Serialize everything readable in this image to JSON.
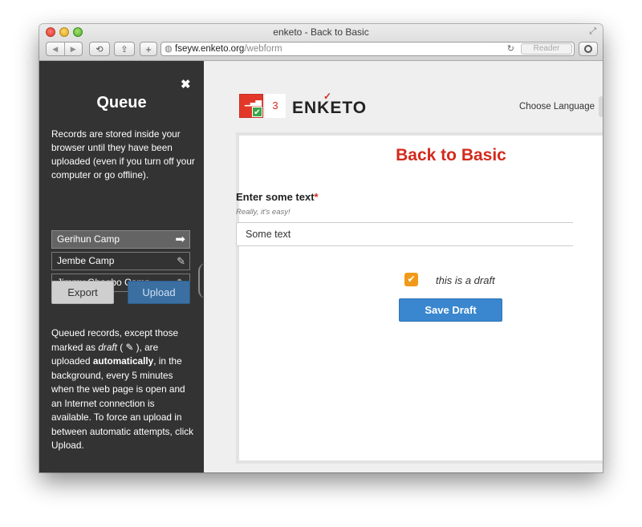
{
  "window": {
    "title": "enketo - Back to Basic"
  },
  "toolbar": {
    "url_host": "fseyw.enketo.org",
    "url_path": "/webform",
    "reader_label": "Reader",
    "add_label": "+"
  },
  "sidebar": {
    "title": "Queue",
    "description": "Records are stored inside your browser until they have been uploaded (even if you turn off your computer or go offline).",
    "records": [
      {
        "name": "Gerihun Camp",
        "icon": "arrow-right-icon"
      },
      {
        "name": "Jembe Camp",
        "icon": "pencil-icon"
      },
      {
        "name": "Jimmy Gbagbo Camp",
        "icon": "pencil-icon"
      }
    ],
    "export_label": "Export",
    "upload_label": "Upload",
    "note_part1": "Queued records, except those marked as ",
    "note_draft": "draft",
    "note_part2": " ), are uploaded ",
    "note_auto": "automatically",
    "note_part3": ", in the background, every 5 minutes when the web page is open and an Internet connection is available. To force an upload in between automatic attempts, click Upload."
  },
  "header": {
    "queue_count": "3",
    "logo_text": "ENKETO",
    "choose_language": "Choose Language"
  },
  "form": {
    "title": "Back to Basic",
    "question_label": "Enter some text",
    "required_mark": "*",
    "hint": "Really, it's easy!",
    "input_value": "Some text",
    "draft_label": "this is a draft",
    "save_draft_label": "Save Draft"
  },
  "colors": {
    "brand_red": "#d42a1c",
    "sidebar_bg": "#333333",
    "upload_blue": "#3b6fa2",
    "save_blue": "#3a87cf",
    "draft_orange": "#f19a1a"
  }
}
